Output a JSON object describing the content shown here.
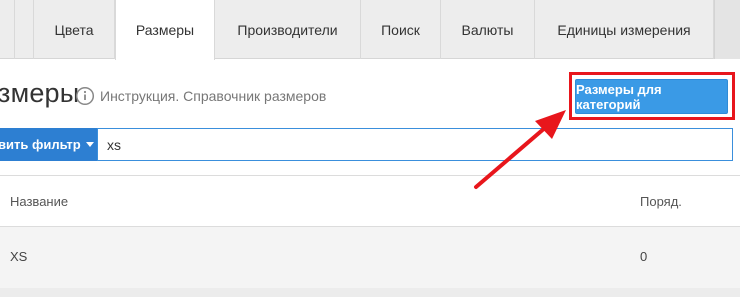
{
  "tabs": [
    {
      "label": "Цвета",
      "active": false
    },
    {
      "label": "Размеры",
      "active": true
    },
    {
      "label": "Производители",
      "active": false
    },
    {
      "label": "Поиск",
      "active": false
    },
    {
      "label": "Валюты",
      "active": false
    },
    {
      "label": "Единицы измерения",
      "active": false
    }
  ],
  "header": {
    "title": "змеры",
    "help_text": "Инструкция. Справочник размеров",
    "category_button": "Размеры для категорий"
  },
  "filter": {
    "button_label": "вить фильтр",
    "search_value": "xs"
  },
  "table": {
    "columns": [
      "Название",
      "Поряд."
    ],
    "rows": [
      {
        "name": "XS",
        "order": "0"
      }
    ]
  },
  "colors": {
    "accent": "#3a9ae6",
    "filter_button": "#2d7fd2",
    "highlight": "#e8161c"
  }
}
